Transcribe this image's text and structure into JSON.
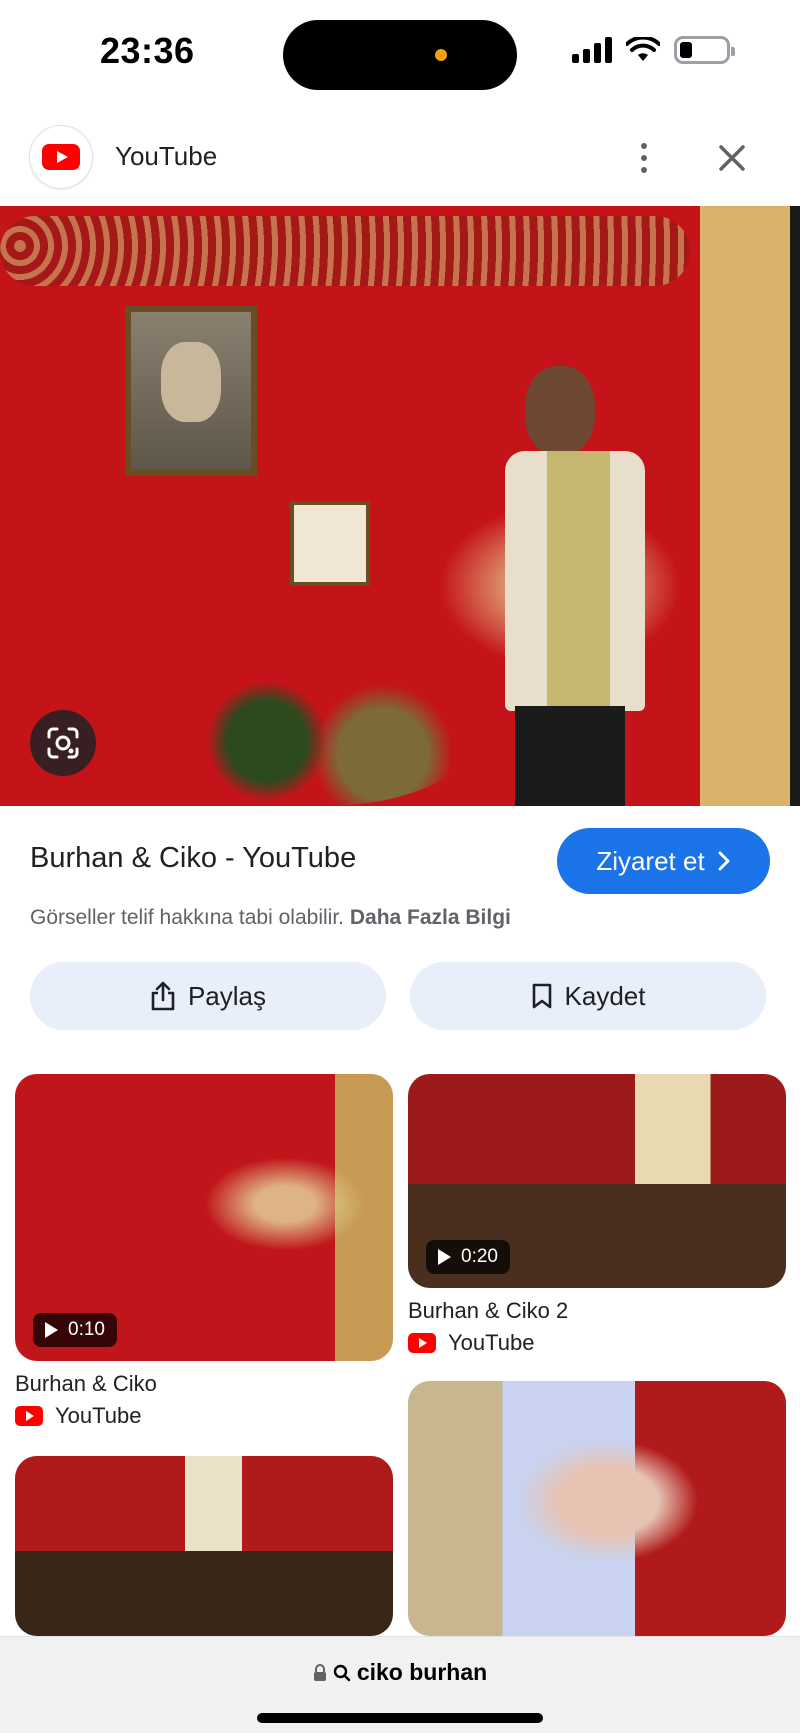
{
  "status_bar": {
    "time": "23:36",
    "icons": [
      "signal-icon",
      "wifi-icon",
      "battery-icon"
    ]
  },
  "header": {
    "site_name": "YouTube",
    "icons": [
      "youtube-logo-icon",
      "more-vert-icon",
      "close-icon"
    ]
  },
  "result": {
    "title": "Burhan & Ciko - YouTube",
    "visit_label": "Ziyaret et",
    "copyright_text": "Görseller telif hakkına tabi olabilir.",
    "learn_more_label": "Daha Fazla Bilgi",
    "share_label": "Paylaş",
    "save_label": "Kaydet"
  },
  "related": [
    {
      "title": "Burhan & Ciko",
      "source": "YouTube",
      "duration": "0:10"
    },
    {
      "title": "Burhan & Ciko 2",
      "source": "YouTube",
      "duration": "0:20"
    }
  ],
  "address_bar": {
    "query": "ciko burhan",
    "icons": [
      "lock-icon",
      "search-icon"
    ]
  },
  "colors": {
    "accent": "#1a73e8",
    "chip_bg": "#e8eefa",
    "youtube_red": "#ff0000"
  }
}
